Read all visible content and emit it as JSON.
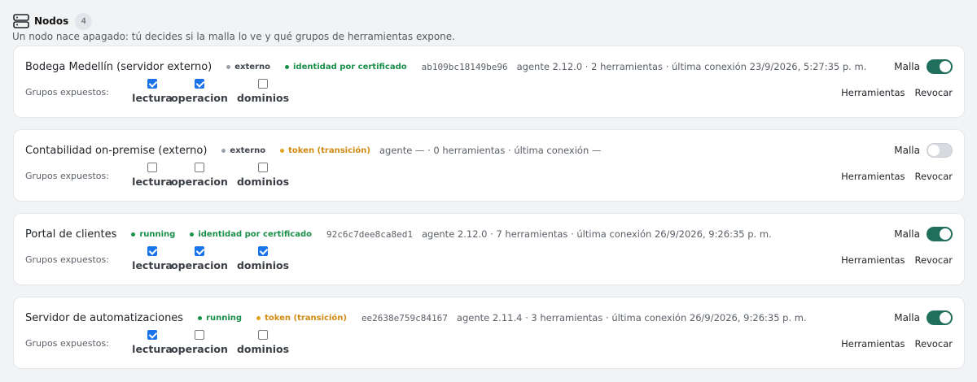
{
  "header": {
    "title": "Nodos",
    "count": "4",
    "subtitle": "Un nodo nace apagado: tú decides si la malla lo ve y qué grupos de herramientas expone."
  },
  "common": {
    "groups_label": "Grupos expuestos:",
    "malla_label": "Malla",
    "tools_action": "Herramientas",
    "revoke_action": "Revocar"
  },
  "nodes": [
    {
      "name": "Bodega Medellín (servidor externo)",
      "status": "externo",
      "auth": "identidad por certificado",
      "fingerprint": "ab109bc18149be96",
      "meta": "agente 2.12.0 · 2 herramientas · última conexión 23/9/2026, 5:27:35 p. m.",
      "malla_on": true,
      "groups": [
        {
          "label": "lectura",
          "checked": true
        },
        {
          "label": "operacion",
          "checked": true
        },
        {
          "label": "dominios",
          "checked": false
        }
      ]
    },
    {
      "name": "Contabilidad on-premise (externo)",
      "status": "externo",
      "auth": "token (transición)",
      "fingerprint": "",
      "meta": "agente — · 0 herramientas · última conexión —",
      "malla_on": false,
      "groups": [
        {
          "label": "lectura",
          "checked": false
        },
        {
          "label": "operacion",
          "checked": false
        },
        {
          "label": "dominios",
          "checked": false
        }
      ]
    },
    {
      "name": "Portal de clientes",
      "status": "running",
      "auth": "identidad por certificado",
      "fingerprint": "92c6c7dee8ca8ed1",
      "meta": "agente 2.12.0 · 7 herramientas · última conexión 26/9/2026, 9:26:35 p. m.",
      "malla_on": true,
      "groups": [
        {
          "label": "lectura",
          "checked": true
        },
        {
          "label": "operacion",
          "checked": true
        },
        {
          "label": "dominios",
          "checked": true
        }
      ]
    },
    {
      "name": "Servidor de automatizaciones",
      "status": "running",
      "auth": "token (transición)",
      "fingerprint": "ee2638e759c84167",
      "meta": "agente 2.11.4 · 3 herramientas · última conexión 26/9/2026, 9:26:35 p. m.",
      "malla_on": true,
      "groups": [
        {
          "label": "lectura",
          "checked": true
        },
        {
          "label": "operacion",
          "checked": false
        },
        {
          "label": "dominios",
          "checked": false
        }
      ]
    }
  ],
  "colors": {
    "toggle_on": "#1f6f5c",
    "checkbox_checked": "#1a73e8",
    "badge_green": "#1a8f4a",
    "badge_orange": "#d08a12",
    "badge_gray": "#9aa1a9"
  }
}
